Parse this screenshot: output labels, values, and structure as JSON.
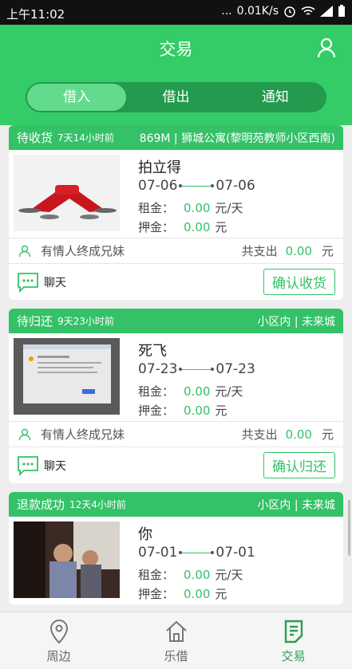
{
  "status_bar": {
    "time": "上午11:02",
    "dots": "...",
    "speed": "0.01K/s"
  },
  "header": {
    "title": "交易"
  },
  "tabs": [
    {
      "label": "借入",
      "active": true
    },
    {
      "label": "借出",
      "active": false
    },
    {
      "label": "通知",
      "active": false
    }
  ],
  "labels": {
    "rent": "租金：",
    "deposit": "押金：",
    "per_day": "元/天",
    "yuan": "元",
    "total": "共支出",
    "chat": "聊天"
  },
  "orders": [
    {
      "status": "待收货",
      "ago": "7天14小时前",
      "location": "869M | 狮城公寓(黎明苑教师小区西南)",
      "item": "拍立得",
      "start": "07-06",
      "end": "07-06",
      "rent": "0.00",
      "deposit": "0.00",
      "owner": "有情人终成兄妹",
      "total": "0.00",
      "action": "确认收货"
    },
    {
      "status": "待归还",
      "ago": "9天23小时前",
      "location": "小区内 | 未来城",
      "item": "死飞",
      "start": "07-23",
      "end": "07-23",
      "rent": "0.00",
      "deposit": "0.00",
      "owner": "有情人终成兄妹",
      "total": "0.00",
      "action": "确认归还"
    },
    {
      "status": "退款成功",
      "ago": "12天4小时前",
      "location": "小区内 | 未来城",
      "item": "你",
      "start": "07-01",
      "end": "07-01",
      "rent": "0.00",
      "deposit": "0.00"
    }
  ],
  "bottom_nav": [
    {
      "label": "周边",
      "icon": "location-pin-icon",
      "active": false
    },
    {
      "label": "乐借",
      "icon": "home-icon",
      "active": false
    },
    {
      "label": "交易",
      "icon": "document-edit-icon",
      "active": true
    }
  ],
  "colors": {
    "primary": "#33cc66",
    "accent_text": "#34c167",
    "active_nav": "#2e9e52"
  }
}
